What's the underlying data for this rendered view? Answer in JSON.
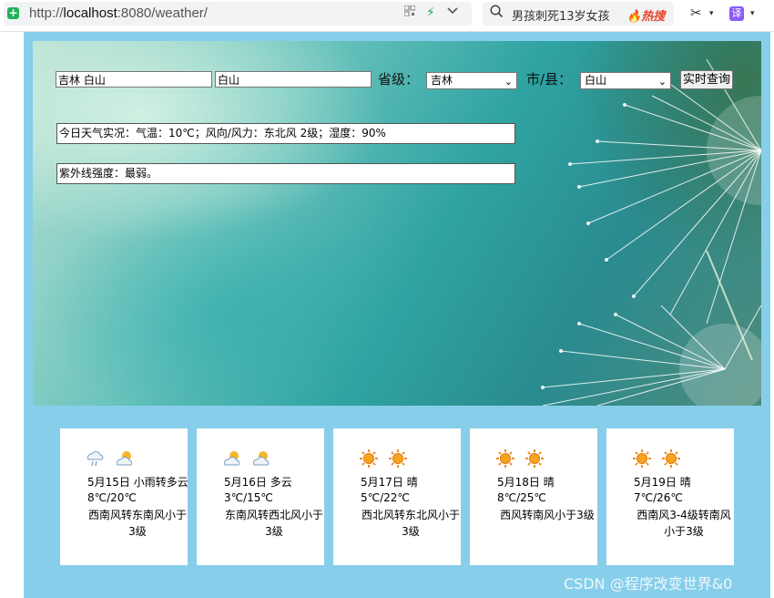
{
  "browser": {
    "url_scheme": "http://",
    "url_host": "localhost",
    "url_rest": ":8080/weather/",
    "search_text": "男孩刺死13岁女孩",
    "hot_label": "热搜",
    "translate_label": "译"
  },
  "form": {
    "location_value": "吉林 白山",
    "city_value": "白山",
    "province_label": "省级：",
    "province_selected": "吉林",
    "city_label": "市/县：",
    "city_selected": "白山",
    "query_button": "实时查询"
  },
  "today": {
    "realtime": "今日天气实况：气温：10℃；风向/风力：东北风 2级；湿度：90%",
    "uv": "紫外线强度：最弱。"
  },
  "forecast": [
    {
      "day": "5月15日 小雨转多云",
      "temp": "8℃/20℃",
      "wind": "西南风转东南风小于3级",
      "icons": [
        "rain-cloud-icon",
        "partly-cloudy-icon"
      ]
    },
    {
      "day": "5月16日 多云",
      "temp": "3℃/15℃",
      "wind": "东南风转西北风小于3级",
      "icons": [
        "partly-cloudy-icon",
        "partly-cloudy-icon"
      ]
    },
    {
      "day": "5月17日 晴",
      "temp": "5℃/22℃",
      "wind": "西北风转东北风小于3级",
      "icons": [
        "sun-icon",
        "sun-icon"
      ]
    },
    {
      "day": "5月18日 晴",
      "temp": "8℃/25℃",
      "wind": "西风转南风小于3级",
      "icons": [
        "sun-icon",
        "sun-icon"
      ]
    },
    {
      "day": "5月19日 晴",
      "temp": "7℃/26℃",
      "wind": "西南风3-4级转南风小于3级",
      "icons": [
        "sun-icon",
        "sun-icon"
      ]
    }
  ],
  "watermark": "CSDN @程序改变世界&0"
}
